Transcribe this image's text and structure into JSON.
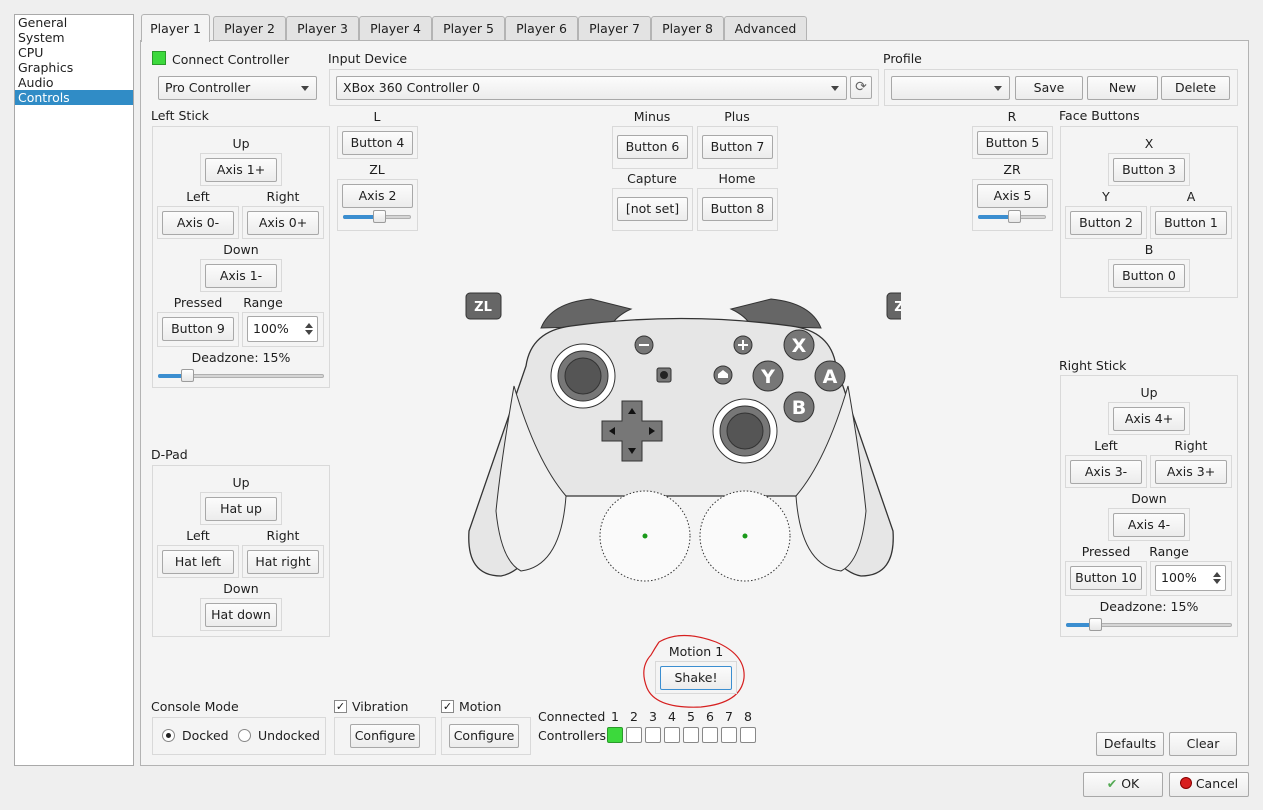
{
  "sidebar": {
    "items": [
      "General",
      "System",
      "CPU",
      "Graphics",
      "Audio",
      "Controls"
    ],
    "selected": "Controls"
  },
  "tabs": [
    "Player 1",
    "Player 2",
    "Player 3",
    "Player 4",
    "Player 5",
    "Player 6",
    "Player 7",
    "Player 8",
    "Advanced"
  ],
  "active_tab": "Player 1",
  "header": {
    "connect_label": "Connect Controller",
    "controller_type": "Pro Controller",
    "input_device_label": "Input Device",
    "input_device": "XBox 360 Controller 0",
    "profile_label": "Profile",
    "profile_value": "",
    "save": "Save",
    "new": "New",
    "delete": "Delete"
  },
  "left_stick": {
    "title": "Left Stick",
    "up_label": "Up",
    "up": "Axis 1+",
    "left_label": "Left",
    "left": "Axis 0-",
    "right_label": "Right",
    "right": "Axis 0+",
    "down_label": "Down",
    "down": "Axis 1-",
    "pressed_label": "Pressed",
    "pressed": "Button 9",
    "range_label": "Range",
    "range": "100%",
    "deadzone": "Deadzone: 15%",
    "deadzone_value": 15
  },
  "shoulders_left": {
    "l_label": "L",
    "l": "Button 4",
    "zl_label": "ZL",
    "zl": "Axis 2",
    "zl_value": 22
  },
  "center_buttons": {
    "minus_label": "Minus",
    "minus": "Button 6",
    "plus_label": "Plus",
    "plus": "Button 7",
    "capture_label": "Capture",
    "capture": "[not set]",
    "home_label": "Home",
    "home": "Button 8"
  },
  "shoulders_right": {
    "r_label": "R",
    "r": "Button 5",
    "zr_label": "ZR",
    "zr": "Axis 5",
    "zr_value": 22
  },
  "face_buttons": {
    "title": "Face Buttons",
    "x_label": "X",
    "x": "Button 3",
    "y_label": "Y",
    "y": "Button 2",
    "a_label": "A",
    "a": "Button 1",
    "b_label": "B",
    "b": "Button 0"
  },
  "right_stick": {
    "title": "Right Stick",
    "up_label": "Up",
    "up": "Axis 4+",
    "left_label": "Left",
    "left": "Axis 3-",
    "right_label": "Right",
    "right": "Axis 3+",
    "down_label": "Down",
    "down": "Axis 4-",
    "pressed_label": "Pressed",
    "pressed": "Button 10",
    "range_label": "Range",
    "range": "100%",
    "deadzone": "Deadzone: 15%",
    "deadzone_value": 15
  },
  "dpad": {
    "title": "D-Pad",
    "up_label": "Up",
    "up": "Hat up",
    "left_label": "Left",
    "left": "Hat left",
    "right_label": "Right",
    "right": "Hat right",
    "down_label": "Down",
    "down": "Hat down"
  },
  "controller_image": {
    "zl": "ZL",
    "zr": "ZR",
    "x": "X",
    "y": "Y",
    "a": "A",
    "b": "B"
  },
  "motion": {
    "label": "Motion 1",
    "button": "Shake!"
  },
  "console_mode": {
    "title": "Console Mode",
    "docked": "Docked",
    "undocked": "Undocked",
    "selected": "Docked"
  },
  "vibration": {
    "label": "Vibration",
    "checked": true,
    "button": "Configure"
  },
  "motion_toggle": {
    "label": "Motion",
    "checked": true,
    "button": "Configure"
  },
  "connected": {
    "label1": "Connected",
    "label2": "Controllers",
    "numbers": [
      "1",
      "2",
      "3",
      "4",
      "5",
      "6",
      "7",
      "8"
    ],
    "states": [
      true,
      false,
      false,
      false,
      false,
      false,
      false,
      false
    ]
  },
  "footer": {
    "defaults": "Defaults",
    "clear": "Clear",
    "ok": "OK",
    "cancel": "Cancel"
  },
  "colors": {
    "selection": "#308cc6",
    "connected_green": "#3cd93c",
    "slider_blue": "#3b8ed0",
    "annotation_red": "#d62020"
  }
}
